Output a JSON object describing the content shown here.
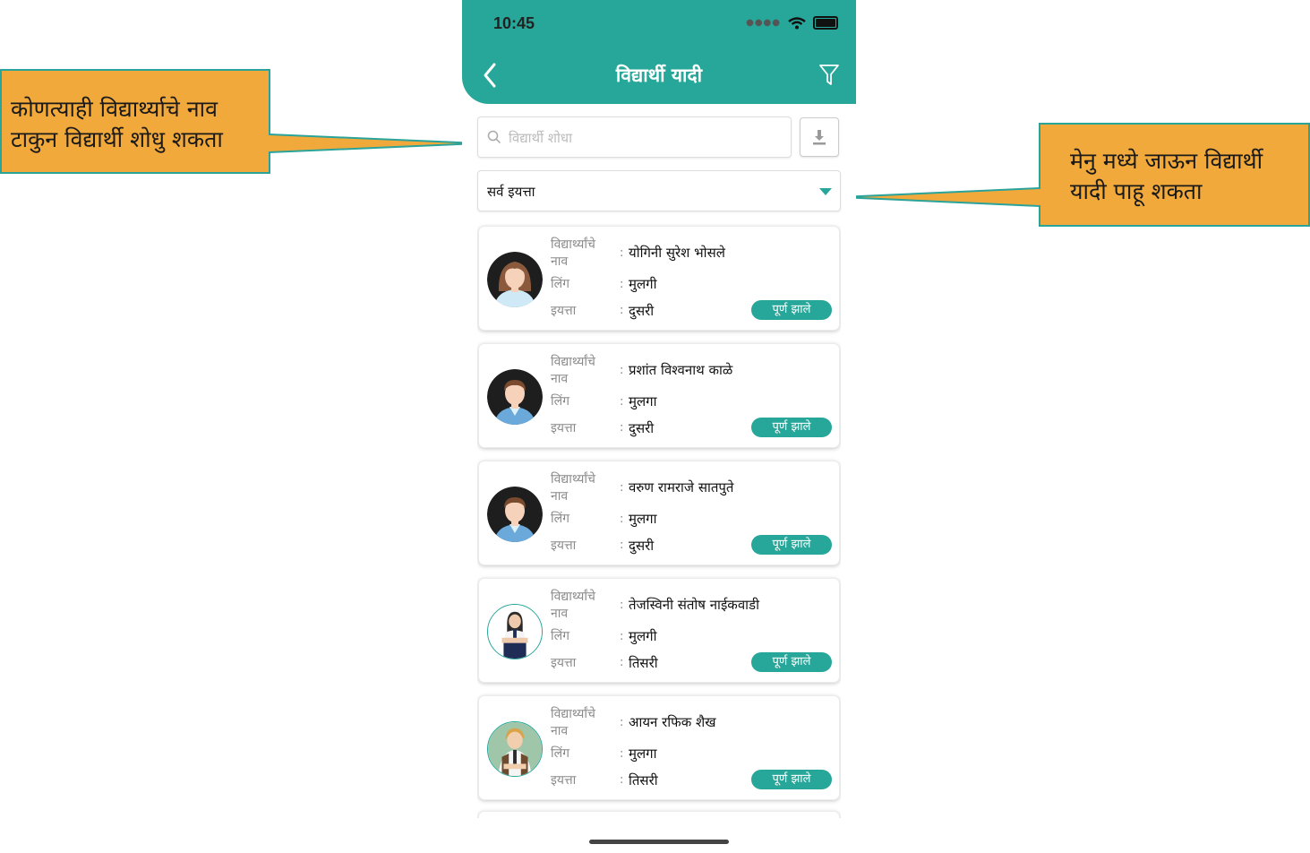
{
  "callouts": {
    "left": [
      "कोणत्याही विद्यार्थ्याचे नाव",
      "टाकुन विद्यार्थी शोधु शकता"
    ],
    "right": [
      "मेनु मध्ये जाऊन विद्यार्थी",
      "यादी पाहू शकता"
    ]
  },
  "colors": {
    "accent": "#27a79a",
    "callout": "#f2a93b"
  },
  "status_bar": {
    "time": "10:45",
    "icons": [
      "signal-icon",
      "wifi-icon",
      "battery-icon"
    ]
  },
  "header": {
    "title": "विद्यार्थी यादी",
    "back_icon": "chevron-left-icon",
    "filter_icon": "filter-icon"
  },
  "search": {
    "placeholder": "विद्यार्थी शोधा",
    "value": ""
  },
  "class_filter": {
    "selected": "सर्व इयत्ता"
  },
  "field_labels": {
    "name": "विद्यार्थ्यांचे नाव",
    "gender": "लिंग",
    "class": "इयत्ता",
    "separator": ":"
  },
  "students": [
    {
      "name": "योगिनी सुरेश भोसले",
      "gender": "मुलगी",
      "class": "दुसरी",
      "status": "पूर्ण झाले",
      "avatar": "girl-avatar"
    },
    {
      "name": "प्रशांत विश्वनाथ काळे",
      "gender": "मुलगा",
      "class": "दुसरी",
      "status": "पूर्ण झाले",
      "avatar": "boy-avatar"
    },
    {
      "name": "वरुण रामराजे सातपुते",
      "gender": "मुलगा",
      "class": "दुसरी",
      "status": "पूर्ण झाले",
      "avatar": "boy-avatar"
    },
    {
      "name": "तेजस्विनी संतोष नाईकवाडी",
      "gender": "मुलगी",
      "class": "तिसरी",
      "status": "पूर्ण झाले",
      "avatar": "student-girl-photo"
    },
    {
      "name": "आयन रफिक शैख",
      "gender": "मुलगा",
      "class": "तिसरी",
      "status": "पूर्ण झाले",
      "avatar": "student-boy-photo"
    }
  ]
}
